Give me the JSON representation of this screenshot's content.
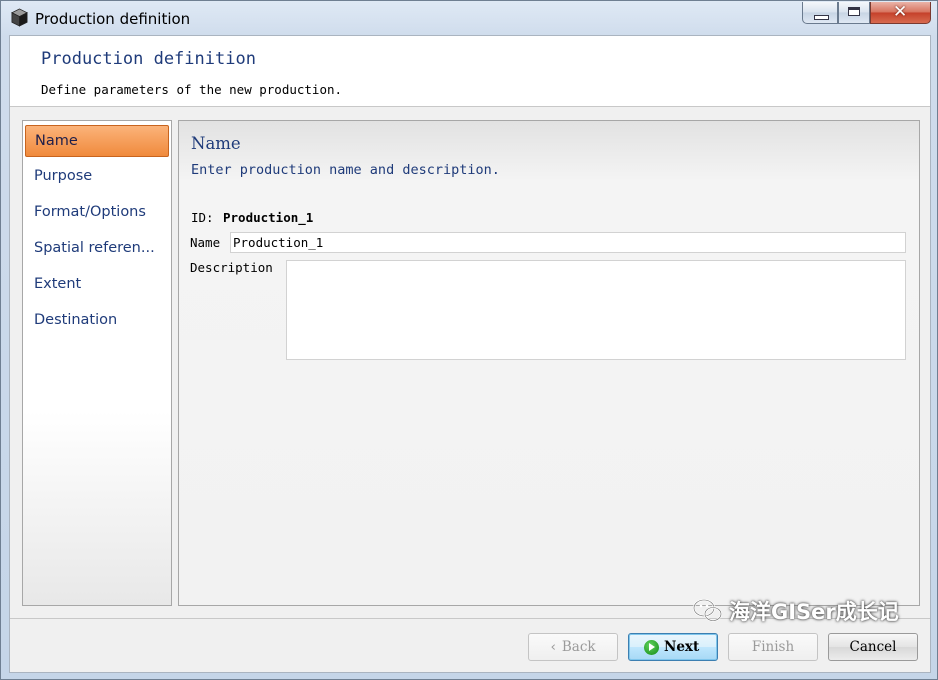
{
  "window": {
    "title": "Production definition",
    "icon": "cube-icon"
  },
  "header": {
    "title": "Production definition",
    "subtitle": "Define parameters of the new production."
  },
  "nav": {
    "items": [
      {
        "label": "Name",
        "active": true
      },
      {
        "label": "Purpose",
        "active": false
      },
      {
        "label": "Format/Options",
        "active": false
      },
      {
        "label": "Spatial referen...",
        "active": false
      },
      {
        "label": "Extent",
        "active": false
      },
      {
        "label": "Destination",
        "active": false
      }
    ]
  },
  "panel": {
    "title": "Name",
    "subtitle": "Enter production name and description.",
    "id_label": "ID:",
    "id_value": "Production_1",
    "name_label": "Name",
    "name_value": "Production_1",
    "description_label": "Description",
    "description_value": ""
  },
  "buttons": {
    "back": "Back",
    "next": "Next",
    "finish": "Finish",
    "cancel": "Cancel"
  },
  "watermark": {
    "text": "海洋GISer成长记",
    "icon": "wechat-icon"
  },
  "colors": {
    "accent_orange": "#f08a3c",
    "label_blue": "#1f3b7a",
    "next_green": "#138a13"
  }
}
